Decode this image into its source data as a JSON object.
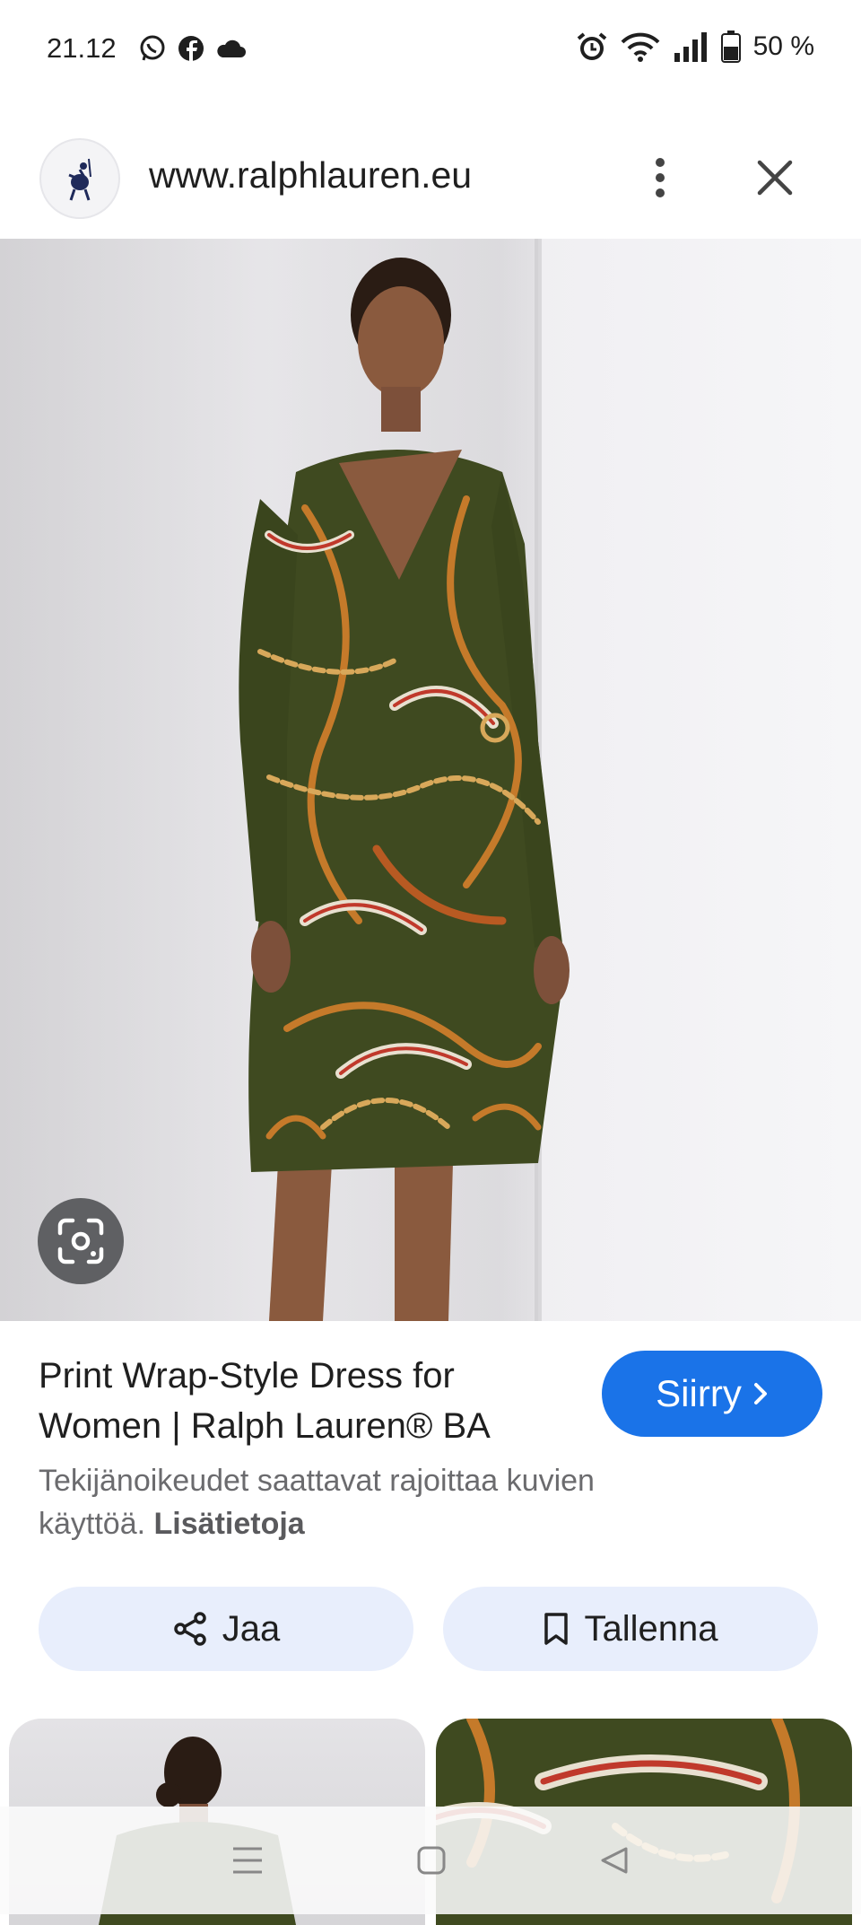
{
  "status_bar": {
    "time": "21.12",
    "app_icons": [
      "whatsapp-icon",
      "facebook-icon",
      "cloud-icon"
    ],
    "status_icons": [
      "alarm-icon",
      "wifi-icon",
      "signal-icon",
      "battery-icon"
    ],
    "battery_text": "50 %"
  },
  "url_bar": {
    "url": "www.ralphlauren.eu"
  },
  "product": {
    "title": "Print Wrap-Style Dress for Women | Ralph Lauren® BA",
    "go_button_label": "Siirry",
    "copyright_text": "Tekijänoikeudet saattavat rajoittaa kuvien käyttöä.",
    "learn_more_link": "Lisätietoja"
  },
  "actions": {
    "share_label": "Jaa",
    "save_label": "Tallenna"
  },
  "colors": {
    "accent": "#1a73e8",
    "action_button_bg": "#e8eefc",
    "dress_green": "#3f4a20"
  }
}
